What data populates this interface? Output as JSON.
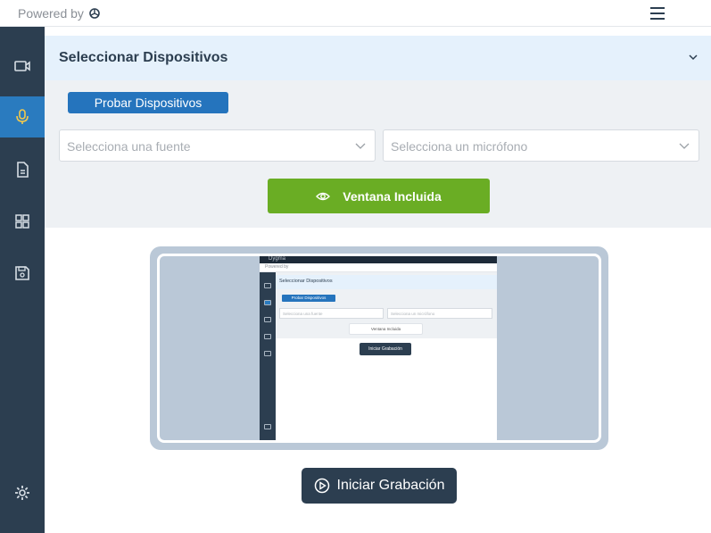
{
  "header": {
    "powered_by": "Powered by",
    "logo_icon": "openai-logo-icon",
    "menu_icon": "hamburger-menu-icon"
  },
  "sidebar": {
    "items": [
      {
        "icon": "video-camera-icon",
        "active": false
      },
      {
        "icon": "microphone-icon",
        "active": true
      },
      {
        "icon": "document-icon",
        "active": false
      },
      {
        "icon": "grid-icon",
        "active": false
      },
      {
        "icon": "save-icon",
        "active": false
      }
    ],
    "settings_icon": "gear-icon"
  },
  "panel": {
    "title": "Seleccionar Dispositivos",
    "collapse_icon": "chevron-down-icon",
    "test_button": "Probar Dispositivos",
    "source_select": {
      "placeholder": "Selecciona una fuente"
    },
    "mic_select": {
      "placeholder": "Selecciona un micrófono"
    },
    "window_button": "Ventana Incluida",
    "window_button_icon": "eye-icon"
  },
  "preview": {
    "window_title": "Dygma",
    "powered_by": "Powered by",
    "panel_title": "Seleccionar Dispositivos",
    "test_button": "Probar Dispositivos",
    "source_placeholder": "Selecciona una fuente",
    "mic_placeholder": "Selecciona un micrófono",
    "window_button": "Ventana Incluida",
    "record_button": "Iniciar Grabación"
  },
  "record": {
    "label": "Iniciar Grabación",
    "icon": "play-circle-icon"
  },
  "colors": {
    "sidebar": "#2c3e50",
    "active": "#2a7bbf",
    "green": "#6aad24",
    "blue_button": "#2574bd"
  }
}
